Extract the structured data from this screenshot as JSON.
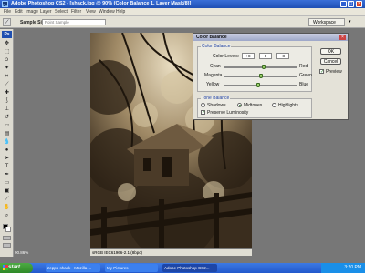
{
  "app": {
    "logo": "Ps",
    "title": "Adobe Photoshop CS2 - [shack.jpg @ 90% (Color Balance 1, Layer Mask/8)]"
  },
  "window_controls": {
    "minimize": "_",
    "maximize": "□",
    "close": "×"
  },
  "menu": [
    "File",
    "Edit",
    "Image",
    "Layer",
    "Select",
    "Filter",
    "View",
    "Window",
    "Help"
  ],
  "options_bar": {
    "tool_icon": "eyedropper-icon",
    "sample_size_label": "Sample Size:",
    "sample_size_value": "Point Sample",
    "workspace_label": "Workspace",
    "workspace_chevron": "▾"
  },
  "toolbox": {
    "logo": "Ps"
  },
  "document": {
    "zoom": "90.86%",
    "status": "sRGB IEC61966-2.1 (8bpc)"
  },
  "color_balance_dialog": {
    "title": "Color Balance",
    "close_label": "×",
    "color_balance_group": "Color Balance",
    "color_levels_label": "Color Levels:",
    "levels": [
      "+8",
      "0",
      "-8"
    ],
    "sliders": [
      {
        "left": "Cyan",
        "right": "Red",
        "value": 8
      },
      {
        "left": "Magenta",
        "right": "Green",
        "value": 0
      },
      {
        "left": "Yellow",
        "right": "Blue",
        "value": -8
      }
    ],
    "tone_balance_group": "Tone Balance",
    "tones": [
      "Shadows",
      "Midtones",
      "Highlights"
    ],
    "selected_tone": "Midtones",
    "preserve_luminosity_label": "Preserve Luminosity",
    "preserve_luminosity": true,
    "ok_label": "OK",
    "cancel_label": "Cancel",
    "preview_label": "Preview",
    "preview": true
  },
  "taskbar": {
    "start_label": "start",
    "items": [
      {
        "label": "zeppo shack - Mozilla ...",
        "active": false
      },
      {
        "label": "My Pictures",
        "active": false
      },
      {
        "label": "Adobe Photoshop CS2...",
        "active": true
      }
    ],
    "clock": "3:20 PM"
  }
}
